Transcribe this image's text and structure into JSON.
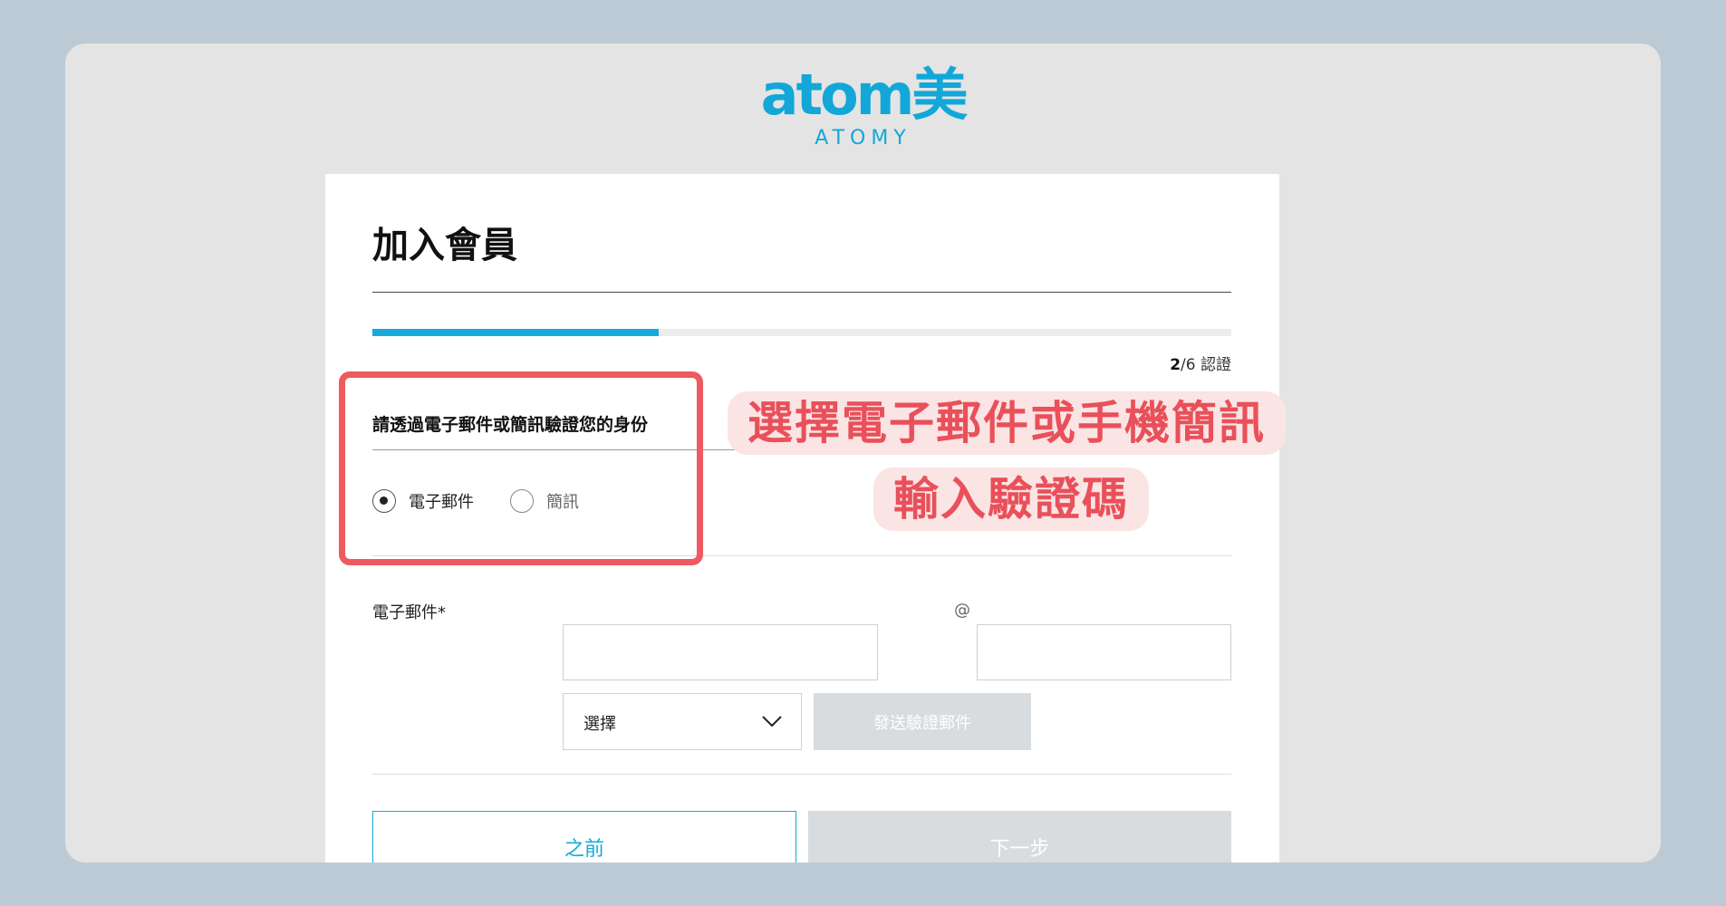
{
  "brand": {
    "logo_main": "atom美",
    "logo_sub": "ATOMY"
  },
  "page": {
    "title": "加入會員",
    "progress_percent": 33.3,
    "step_current": "2",
    "step_rest": "/6 認證"
  },
  "verify": {
    "instruction": "請透過電子郵件或簡訊驗證您的身份",
    "options": [
      {
        "label": "電子郵件",
        "selected": true
      },
      {
        "label": "簡訊",
        "selected": false
      }
    ]
  },
  "email": {
    "label": "電子郵件*",
    "local_value": "",
    "at_sign": "@",
    "domain_value": "",
    "domain_select": "選擇",
    "send_button": "發送驗證郵件"
  },
  "nav": {
    "prev": "之前",
    "next": "下一步"
  },
  "annotation": {
    "line1": "選擇電子郵件或手機簡訊",
    "line2": "輸入驗證碼"
  },
  "colors": {
    "accent": "#17a9d8",
    "annotation": "#ee5a5f",
    "disabled": "#d8dcdf"
  }
}
